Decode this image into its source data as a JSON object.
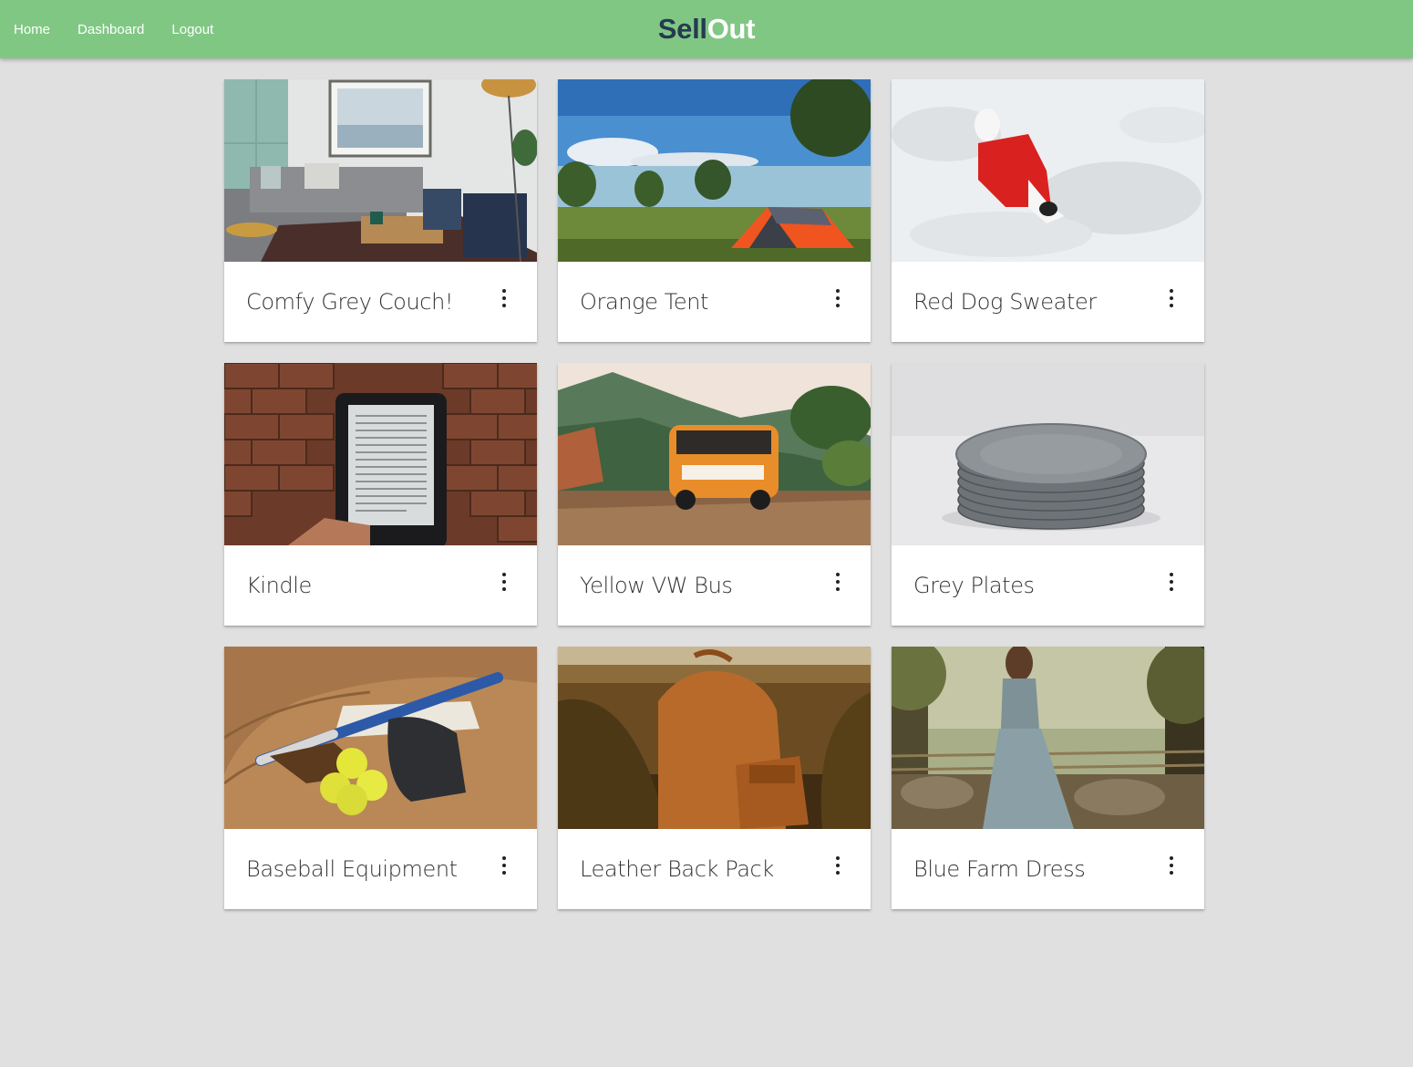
{
  "nav": {
    "links": [
      "Home",
      "Dashboard",
      "Logout"
    ],
    "brand_part1": "Sell",
    "brand_part2": "Out",
    "bg_color": "#81c784",
    "brand_dark_color": "#263a50"
  },
  "listings": [
    {
      "title": "Comfy Grey Couch!",
      "image": "living-room-photo"
    },
    {
      "title": "Orange Tent",
      "image": "tent-lake-photo"
    },
    {
      "title": "Red Dog Sweater",
      "image": "dog-in-snow-photo"
    },
    {
      "title": "Kindle",
      "image": "kindle-brick-photo"
    },
    {
      "title": "Yellow VW Bus",
      "image": "vw-bus-photo"
    },
    {
      "title": "Grey Plates",
      "image": "plates-stack-photo"
    },
    {
      "title": "Baseball Equipment",
      "image": "baseball-gear-photo"
    },
    {
      "title": "Leather Back Pack",
      "image": "leather-backpack-photo"
    },
    {
      "title": "Blue Farm Dress",
      "image": "farm-dress-photo"
    }
  ],
  "menu_icon": "more-vert-icon"
}
